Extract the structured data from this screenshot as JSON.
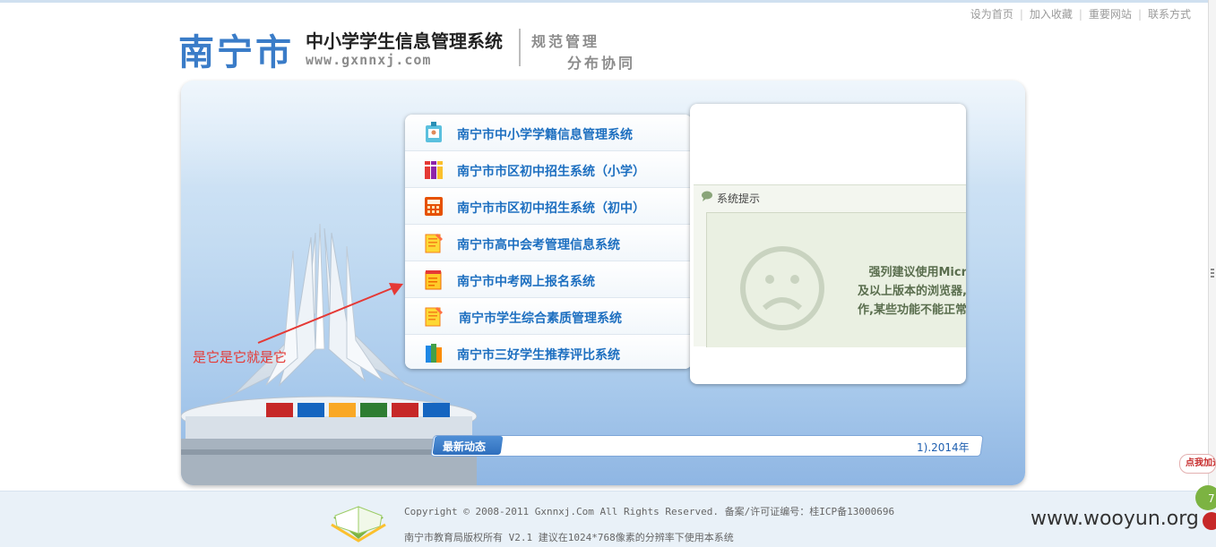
{
  "top_links": [
    "设为首页",
    "加入收藏",
    "重要网站",
    "联系方式"
  ],
  "header": {
    "city": "南宁市",
    "title": "中小学学生信息管理系统",
    "url": "www.gxnnxj.com",
    "slogan_line1": "规范管理",
    "slogan_line2": "分布协同"
  },
  "systems": [
    {
      "label": "南宁市中小学学籍信息管理系统",
      "icon": "id-badge-icon"
    },
    {
      "label": "南宁市市区初中招生系统（小学）",
      "icon": "books-icon"
    },
    {
      "label": "南宁市市区初中招生系统（初中）",
      "icon": "calculator-icon"
    },
    {
      "label": "南宁市高中会考管理信息系统",
      "icon": "notepad-icon"
    },
    {
      "label": "南宁市中考网上报名系统",
      "icon": "notepad-red-icon"
    },
    {
      "label": "南宁市学生综合素质管理系统",
      "icon": "notepad-icon"
    },
    {
      "label": "南宁市三好学生推荐评比系统",
      "icon": "book-stack-icon"
    }
  ],
  "notice": {
    "title": "系统提示",
    "lines": [
      "强列建议使用Micr",
      "及以上版本的浏览器,",
      "作,某些功能不能正常"
    ]
  },
  "news": {
    "tag": "最新动态",
    "text": "1).2014年"
  },
  "annotation": "是它是它就是它",
  "footer": {
    "copyright": "Copyright © 2008-2011  Gxnnxj.Com  All Rights Reserved. 备案/许可证编号：桂ICP备13000696",
    "owner": "南宁市教育局版权所有 V2.1  建议在1024*768像素的分辨率下使用本系统"
  },
  "float_badge": "点我加速",
  "watermark": "www.wooyun.org",
  "colors": {
    "accent": "#1d6fc0",
    "logo": "#3a7cc8",
    "annotation": "#e53935"
  }
}
